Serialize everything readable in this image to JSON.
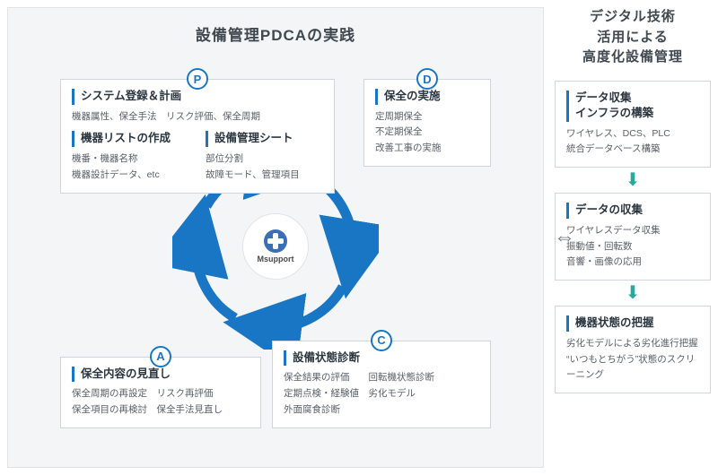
{
  "left": {
    "title": "設備管理PDCAの実践",
    "logo_text": "Msupport",
    "pdca": {
      "p": {
        "badge": "P",
        "h1": "システム登録＆計画",
        "b1": "機器属性、保全手法　リスク評価、保全周期",
        "col1_h": "機器リストの作成",
        "col1_b": "機番・機器名称\n機器設計データ、etc",
        "col2_h": "設備管理シート",
        "col2_b": "部位分割\n故障モード、管理項目"
      },
      "d": {
        "badge": "D",
        "h": "保全の実施",
        "b": "定周期保全\n不定期保全\n改善工事の実施"
      },
      "c": {
        "badge": "C",
        "h": "設備状態診断",
        "b": "保全結果の評価　　回転機状態診断\n定期点検・経験値　劣化モデル\n外面腐食診断"
      },
      "a": {
        "badge": "A",
        "h": "保全内容の見直し",
        "b": "保全周期の再設定　リスク再評価\n保全項目の再検討　保全手法見直し"
      }
    }
  },
  "right": {
    "title": "デジタル技術\n活用による\n高度化設備管理",
    "boxes": [
      {
        "h": "データ収集\nインフラの構築",
        "b": "ワイヤレス、DCS、PLC\n統合データベース構築"
      },
      {
        "h": "データの収集",
        "b": "ワイヤレスデータ収集\n振動値・回転数\n音響・画像の応用"
      },
      {
        "h": "機器状態の把握",
        "b": "劣化モデルによる劣化進行把握\n“いつもとちがう”状態のスクリーニング"
      }
    ]
  }
}
